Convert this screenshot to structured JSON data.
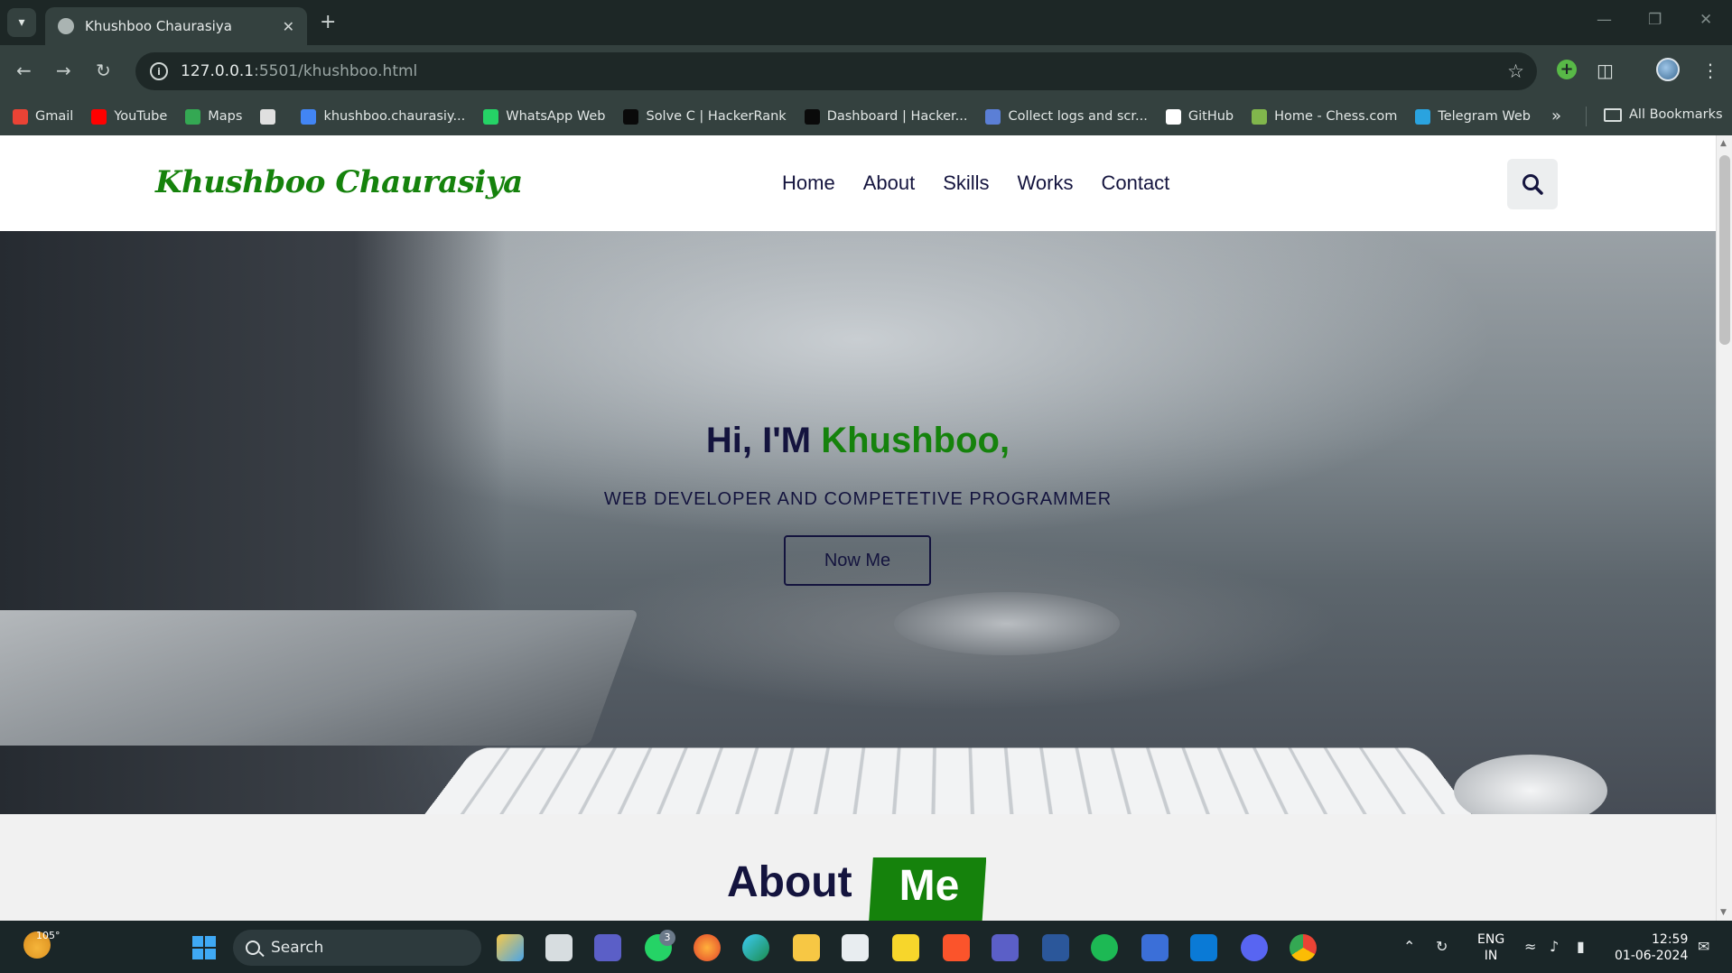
{
  "browser": {
    "tab_title": "Khushboo Chaurasiya",
    "url_host": "127.0.0.1",
    "url_rest": ":5501/khushboo.html",
    "bookmarks": [
      {
        "label": "Gmail",
        "color": "#ea4335"
      },
      {
        "label": "YouTube",
        "color": "#ff0000"
      },
      {
        "label": "Maps",
        "color": "#34a853"
      },
      {
        "label": "",
        "color": "#e0e0e0"
      },
      {
        "label": "khushboo.chaurasiy...",
        "color": "#4285f4"
      },
      {
        "label": "WhatsApp Web",
        "color": "#25d366"
      },
      {
        "label": "Solve C | HackerRank",
        "color": "#0a0a0a"
      },
      {
        "label": "Dashboard | Hacker...",
        "color": "#0a0a0a"
      },
      {
        "label": "Collect logs and scr...",
        "color": "#5b7fd6"
      },
      {
        "label": "GitHub",
        "color": "#ffffff"
      },
      {
        "label": "Home - Chess.com",
        "color": "#81b64c"
      },
      {
        "label": "Telegram Web",
        "color": "#2aa3df"
      }
    ],
    "all_bookmarks": "All Bookmarks"
  },
  "site": {
    "logo": "Khushboo Chaurasiya",
    "nav": [
      "Home",
      "About",
      "Skills",
      "Works",
      "Contact"
    ],
    "hero": {
      "greeting": "Hi, I'M ",
      "name": "Khushboo,",
      "subtitle": "WEB DEVELOPER AND COMPETETIVE PROGRAMMER",
      "button": "Now Me"
    },
    "about": {
      "heading_1": "About",
      "heading_2": "Me"
    },
    "colors": {
      "accent": "#15820c",
      "navy": "#14143e"
    }
  },
  "taskbar": {
    "weather_temp": "105°",
    "search_label": "Search",
    "whatsapp_badge": "3",
    "lang_1": "ENG",
    "lang_2": "IN",
    "time": "12:59",
    "date": "01-06-2024"
  }
}
